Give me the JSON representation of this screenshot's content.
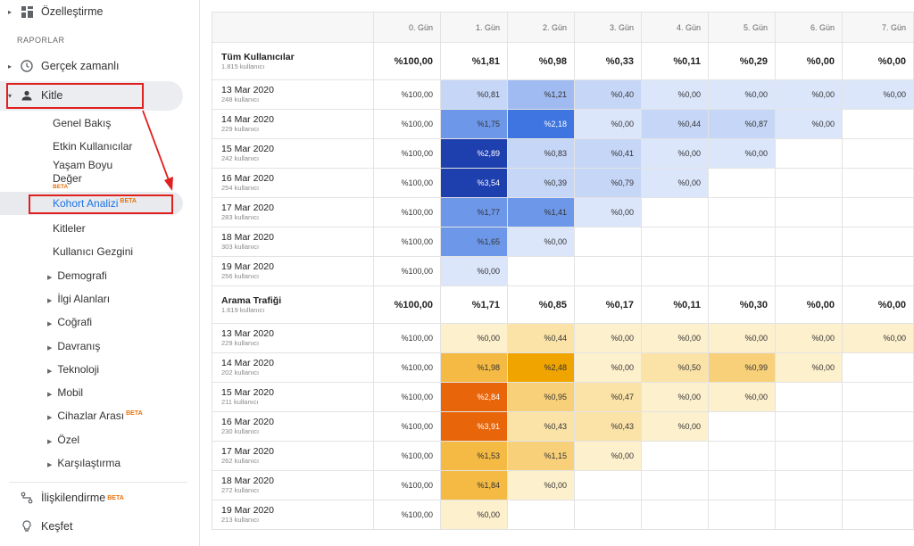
{
  "sidebar": {
    "top_item": "Özelleştirme",
    "section_label": "RAPORLAR",
    "realtime": "Gerçek zamanlı",
    "audience": "Kitle",
    "audience_items": [
      "Genel Bakış",
      "Etkin Kullanıcılar",
      "Yaşam Boyu",
      "Değer"
    ],
    "cohort": "Kohort Analizi",
    "beta": "BETA",
    "audiences": "Kitleler",
    "user_explorer": "Kullanıcı Gezgini",
    "categories": [
      "Demografi",
      "İlgi Alanları",
      "Coğrafi",
      "Davranış",
      "Teknoloji",
      "Mobil",
      "Cihazlar Arası",
      "Özel",
      "Karşılaştırma"
    ],
    "attribution": "İlişkilendirme",
    "discover": "Keşfet"
  },
  "table": {
    "day_headers": [
      "0. Gün",
      "1. Gün",
      "2. Gün",
      "3. Gün",
      "4. Gün",
      "5. Gün",
      "6. Gün",
      "7. Gün"
    ],
    "sections": [
      {
        "title": "Tüm Kullanıcılar",
        "subtitle": "1.815 kullanıcı",
        "totals": [
          "%100,00",
          "%1,81",
          "%0,98",
          "%0,33",
          "%0,11",
          "%0,29",
          "%0,00",
          "%0,00"
        ],
        "rows": [
          {
            "date": "13 Mar 2020",
            "users": "248 kullanıcı",
            "values": [
              "%100,00",
              "%0,81",
              "%1,21",
              "%0,40",
              "%0,00",
              "%0,00",
              "%0,00",
              "%0,00"
            ]
          },
          {
            "date": "14 Mar 2020",
            "users": "229 kullanıcı",
            "values": [
              "%100,00",
              "%1,75",
              "%2,18",
              "%0,00",
              "%0,44",
              "%0,87",
              "%0,00"
            ]
          },
          {
            "date": "15 Mar 2020",
            "users": "242 kullanıcı",
            "values": [
              "%100,00",
              "%2,89",
              "%0,83",
              "%0,41",
              "%0,00",
              "%0,00"
            ]
          },
          {
            "date": "16 Mar 2020",
            "users": "254 kullanıcı",
            "values": [
              "%100,00",
              "%3,54",
              "%0,39",
              "%0,79",
              "%0,00"
            ]
          },
          {
            "date": "17 Mar 2020",
            "users": "283 kullanıcı",
            "values": [
              "%100,00",
              "%1,77",
              "%1,41",
              "%0,00"
            ]
          },
          {
            "date": "18 Mar 2020",
            "users": "303 kullanıcı",
            "values": [
              "%100,00",
              "%1,65",
              "%0,00"
            ]
          },
          {
            "date": "19 Mar 2020",
            "users": "256 kullanıcı",
            "values": [
              "%100,00",
              "%0,00"
            ]
          }
        ]
      },
      {
        "title": "Arama Trafiği",
        "subtitle": "1.619 kullanıcı",
        "totals": [
          "%100,00",
          "%1,71",
          "%0,85",
          "%0,17",
          "%0,11",
          "%0,30",
          "%0,00",
          "%0,00"
        ],
        "rows": [
          {
            "date": "13 Mar 2020",
            "users": "229 kullanıcı",
            "values": [
              "%100,00",
              "%0,00",
              "%0,44",
              "%0,00",
              "%0,00",
              "%0,00",
              "%0,00",
              "%0,00"
            ]
          },
          {
            "date": "14 Mar 2020",
            "users": "202 kullanıcı",
            "values": [
              "%100,00",
              "%1,98",
              "%2,48",
              "%0,00",
              "%0,50",
              "%0,99",
              "%0,00"
            ]
          },
          {
            "date": "15 Mar 2020",
            "users": "211 kullanıcı",
            "values": [
              "%100,00",
              "%2,84",
              "%0,95",
              "%0,47",
              "%0,00",
              "%0,00"
            ]
          },
          {
            "date": "16 Mar 2020",
            "users": "230 kullanıcı",
            "values": [
              "%100,00",
              "%3,91",
              "%0,43",
              "%0,43",
              "%0,00"
            ]
          },
          {
            "date": "17 Mar 2020",
            "users": "262 kullanıcı",
            "values": [
              "%100,00",
              "%1,53",
              "%1,15",
              "%0,00"
            ]
          },
          {
            "date": "18 Mar 2020",
            "users": "272 kullanıcı",
            "values": [
              "%100,00",
              "%1,84",
              "%0,00"
            ]
          },
          {
            "date": "19 Mar 2020",
            "users": "213 kullanıcı",
            "values": [
              "%100,00",
              "%0,00"
            ]
          }
        ]
      }
    ]
  },
  "colors": {
    "annotation_red": "#e0201f",
    "blue_scale": [
      "#dbe6fb",
      "#c6d6f7",
      "#9fbbf1",
      "#6d98ea",
      "#3e75e0",
      "#1e3fae"
    ],
    "orange_scale": [
      "#fdf0cd",
      "#fbe3a8",
      "#f8d07a",
      "#f5ba43",
      "#f0a400",
      "#e8650a"
    ]
  }
}
